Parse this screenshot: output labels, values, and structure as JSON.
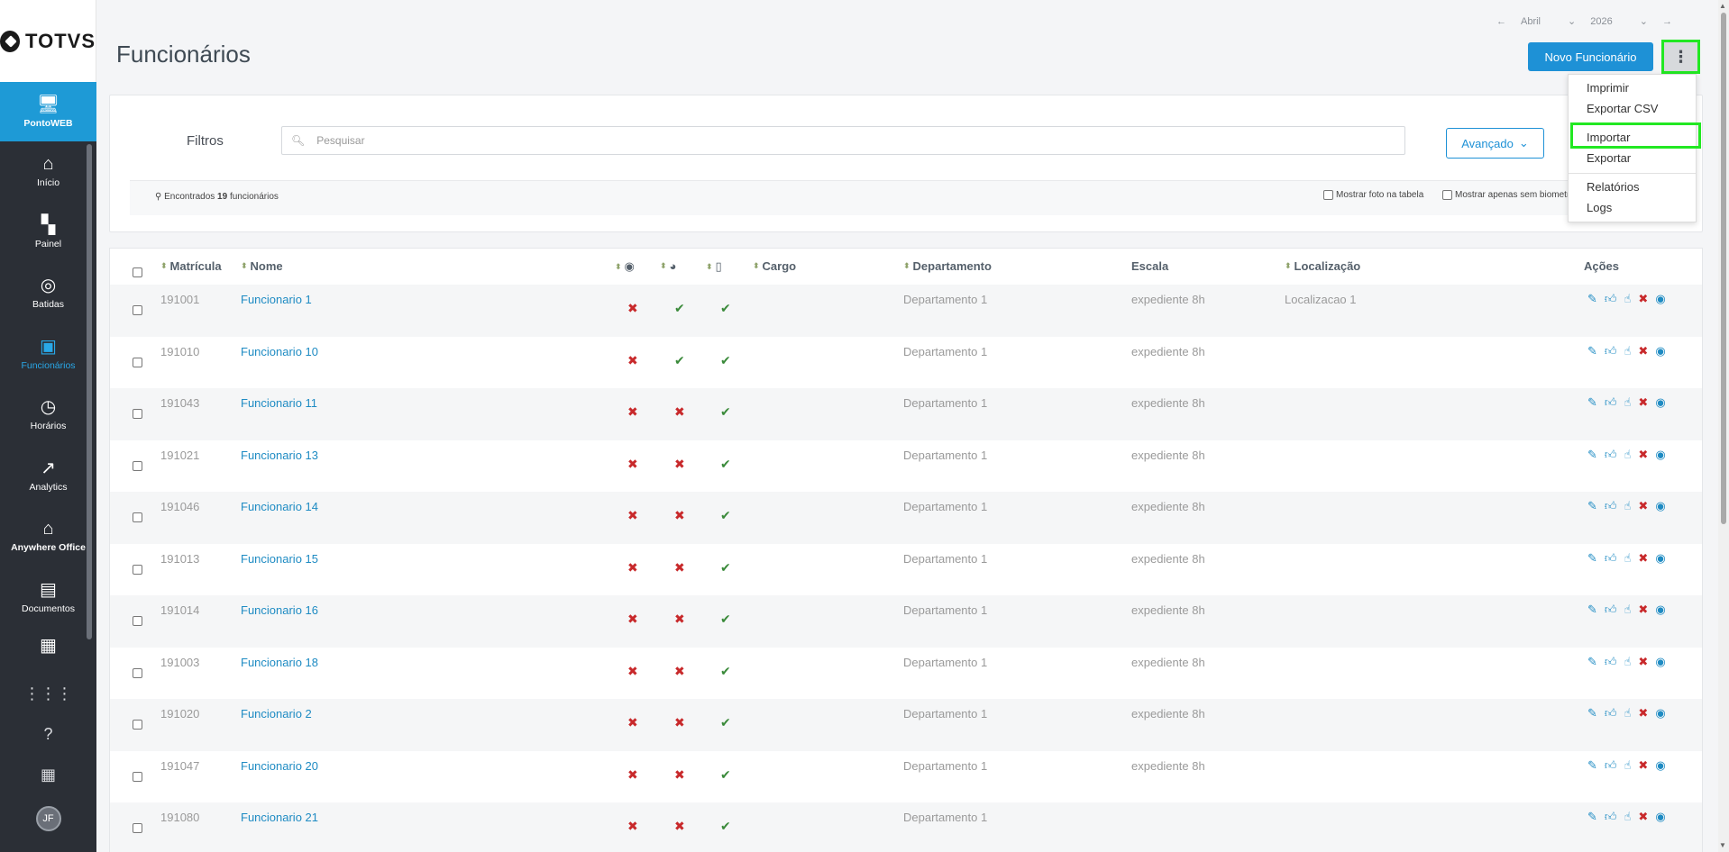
{
  "brand": {
    "logo_text": "TOTVS",
    "accent": "#1e91d6",
    "highlight": "#22e822"
  },
  "sidebar": {
    "items": [
      {
        "label": "PontoWEB",
        "icon": "monitor-icon"
      },
      {
        "label": "Início",
        "icon": "home-icon"
      },
      {
        "label": "Painel",
        "icon": "dashboard-icon"
      },
      {
        "label": "Batidas",
        "icon": "fingerprint-icon"
      },
      {
        "label": "Funcionários",
        "icon": "employee-badge-icon"
      },
      {
        "label": "Horários",
        "icon": "clock-icon"
      },
      {
        "label": "Analytics",
        "icon": "trend-icon"
      },
      {
        "label": "Anywhere Office",
        "icon": "house-office-icon"
      },
      {
        "label": "Documentos",
        "icon": "document-icon"
      }
    ],
    "avatar": "JF"
  },
  "header": {
    "title": "Funcionários",
    "month": "Abril",
    "year": "2026",
    "new_button": "Novo Funcionário"
  },
  "menu": {
    "items": [
      "Imprimir",
      "Exportar CSV",
      "Importar",
      "Exportar",
      "Relatórios",
      "Logs"
    ]
  },
  "filters": {
    "label": "Filtros",
    "search_placeholder": "Pesquisar",
    "advanced": "Avançado",
    "found_prefix": "Encontrados",
    "found_count": "19",
    "found_suffix": "funcionários",
    "show_photo": "Mostrar foto na tabela",
    "show_no_biometry": "Mostrar apenas sem biometria"
  },
  "table": {
    "headers": {
      "matricula": "Matrícula",
      "nome": "Nome",
      "cargo": "Cargo",
      "departamento": "Departamento",
      "escala": "Escala",
      "localizacao": "Localização",
      "acoes": "Ações"
    },
    "rows": [
      {
        "matricula": "191001",
        "nome": "Funcionario 1",
        "bio": false,
        "web": true,
        "mobile": true,
        "departamento": "Departamento 1",
        "escala": "expediente 8h",
        "localizacao": "Localizacao 1"
      },
      {
        "matricula": "191010",
        "nome": "Funcionario 10",
        "bio": false,
        "web": true,
        "mobile": true,
        "departamento": "Departamento 1",
        "escala": "expediente 8h",
        "localizacao": ""
      },
      {
        "matricula": "191043",
        "nome": "Funcionario 11",
        "bio": false,
        "web": false,
        "mobile": true,
        "departamento": "Departamento 1",
        "escala": "expediente 8h",
        "localizacao": ""
      },
      {
        "matricula": "191021",
        "nome": "Funcionario 13",
        "bio": false,
        "web": false,
        "mobile": true,
        "departamento": "Departamento 1",
        "escala": "expediente 8h",
        "localizacao": ""
      },
      {
        "matricula": "191046",
        "nome": "Funcionario 14",
        "bio": false,
        "web": false,
        "mobile": true,
        "departamento": "Departamento 1",
        "escala": "expediente 8h",
        "localizacao": ""
      },
      {
        "matricula": "191013",
        "nome": "Funcionario 15",
        "bio": false,
        "web": false,
        "mobile": true,
        "departamento": "Departamento 1",
        "escala": "expediente 8h",
        "localizacao": ""
      },
      {
        "matricula": "191014",
        "nome": "Funcionario 16",
        "bio": false,
        "web": false,
        "mobile": true,
        "departamento": "Departamento 1",
        "escala": "expediente 8h",
        "localizacao": ""
      },
      {
        "matricula": "191003",
        "nome": "Funcionario 18",
        "bio": false,
        "web": false,
        "mobile": true,
        "departamento": "Departamento 1",
        "escala": "expediente 8h",
        "localizacao": ""
      },
      {
        "matricula": "191020",
        "nome": "Funcionario 2",
        "bio": false,
        "web": false,
        "mobile": true,
        "departamento": "Departamento 1",
        "escala": "expediente 8h",
        "localizacao": ""
      },
      {
        "matricula": "191047",
        "nome": "Funcionario 20",
        "bio": false,
        "web": false,
        "mobile": true,
        "departamento": "Departamento 1",
        "escala": "expediente 8h",
        "localizacao": ""
      },
      {
        "matricula": "191080",
        "nome": "Funcionario 21",
        "bio": false,
        "web": false,
        "mobile": true,
        "departamento": "Departamento 1",
        "escala": "",
        "localizacao": ""
      }
    ]
  }
}
